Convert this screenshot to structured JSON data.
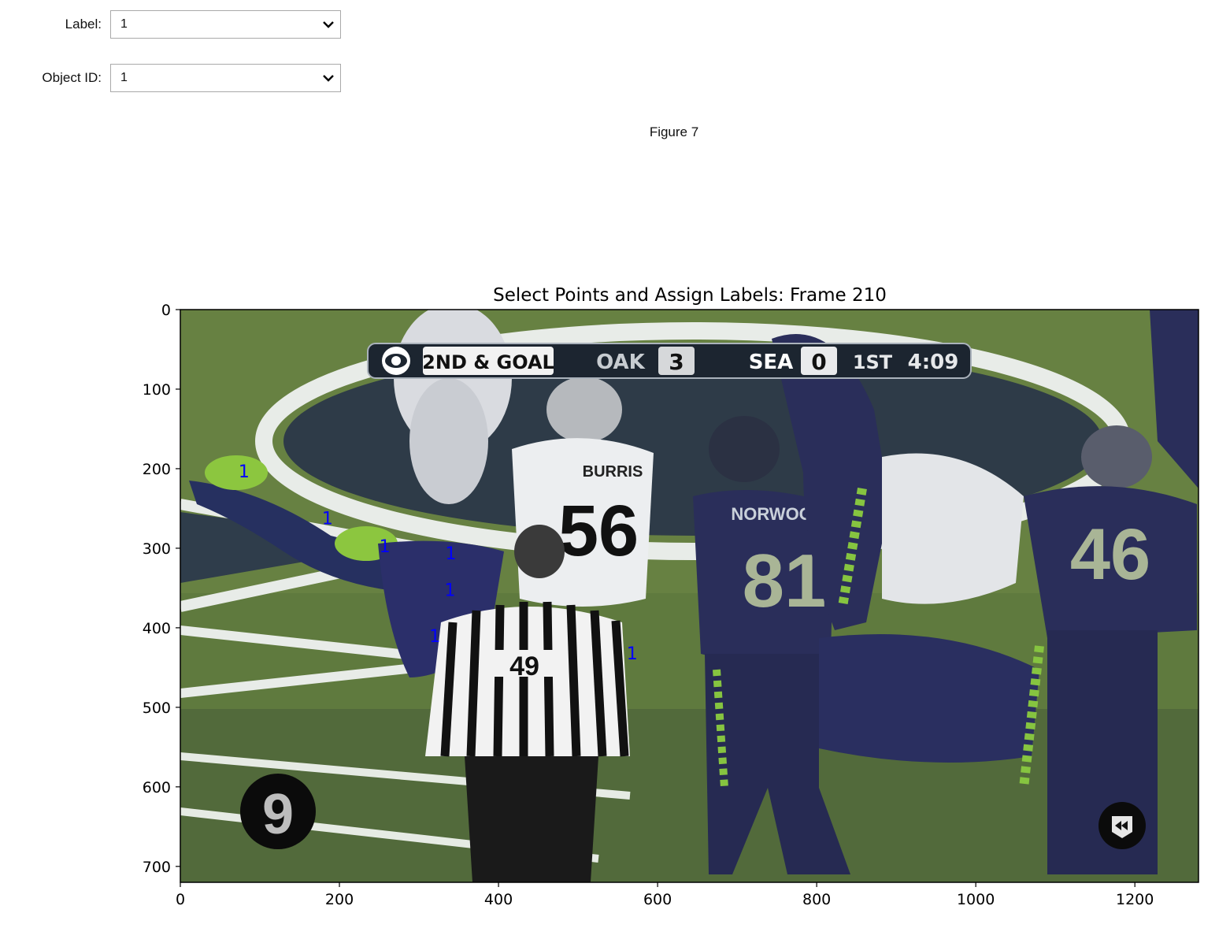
{
  "controls": {
    "label": {
      "caption": "Label:",
      "value": "1"
    },
    "object_id": {
      "caption": "Object ID:",
      "value": "1"
    }
  },
  "figure": {
    "title": "Figure 7"
  },
  "plot": {
    "title": "Select Points and Assign Labels: Frame 210",
    "xlim": [
      0,
      1280
    ],
    "ylim": [
      0,
      720
    ],
    "y_inverted": true,
    "x_ticks": [
      0,
      200,
      400,
      600,
      800,
      1000,
      1200
    ],
    "y_ticks": [
      0,
      100,
      200,
      300,
      400,
      500,
      600,
      700
    ],
    "points": [
      {
        "x": 80,
        "y": 203,
        "label": "1"
      },
      {
        "x": 185,
        "y": 262,
        "label": "1"
      },
      {
        "x": 257,
        "y": 297,
        "label": "1"
      },
      {
        "x": 340,
        "y": 306,
        "label": "1"
      },
      {
        "x": 339,
        "y": 352,
        "label": "1"
      },
      {
        "x": 320,
        "y": 410,
        "label": "1"
      },
      {
        "x": 568,
        "y": 432,
        "label": "1"
      }
    ],
    "point_color": "#0000ff"
  },
  "frame_overlay": {
    "scorebug": {
      "down": "2ND & GOAL",
      "team1": "OAK",
      "score1": "3",
      "team2": "SEA",
      "score2": "0",
      "quarter": "1ST",
      "clock": "4:09"
    },
    "players": [
      {
        "name": "BURRIS",
        "number": "56"
      },
      {
        "name": "NORWOOD",
        "number": "81"
      },
      {
        "name": "",
        "number": "46"
      }
    ],
    "referee_number": "49",
    "corner_logo_text": "9"
  }
}
